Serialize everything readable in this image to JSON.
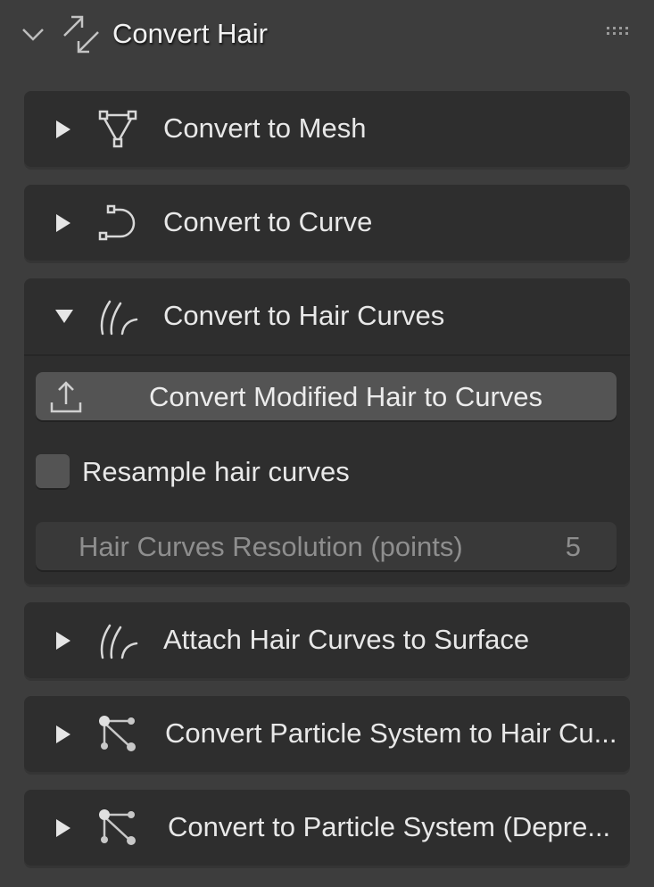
{
  "header": {
    "title": "Convert Hair",
    "expanded": true,
    "icon": "convert-arrows-icon"
  },
  "panels": [
    {
      "label": "Convert to Mesh",
      "icon": "mesh-icon",
      "expanded": false
    },
    {
      "label": "Convert to Curve",
      "icon": "curve-icon",
      "expanded": false
    },
    {
      "label": "Convert to Hair Curves",
      "icon": "hair-curves-icon",
      "expanded": true
    },
    {
      "label": "Attach Hair Curves to Surface",
      "icon": "hair-curves-icon",
      "expanded": false
    },
    {
      "label": "Convert Particle System to Hair Cu...",
      "icon": "particle-icon",
      "expanded": false
    },
    {
      "label": "Convert to Particle System (Depre...",
      "icon": "particle-icon",
      "expanded": false
    }
  ],
  "hair_curves": {
    "button_label": "Convert Modified Hair to Curves",
    "checkbox_label": "Resample hair curves",
    "checkbox_checked": false,
    "field_label": "Hair Curves Resolution (points)",
    "field_value": "5"
  }
}
